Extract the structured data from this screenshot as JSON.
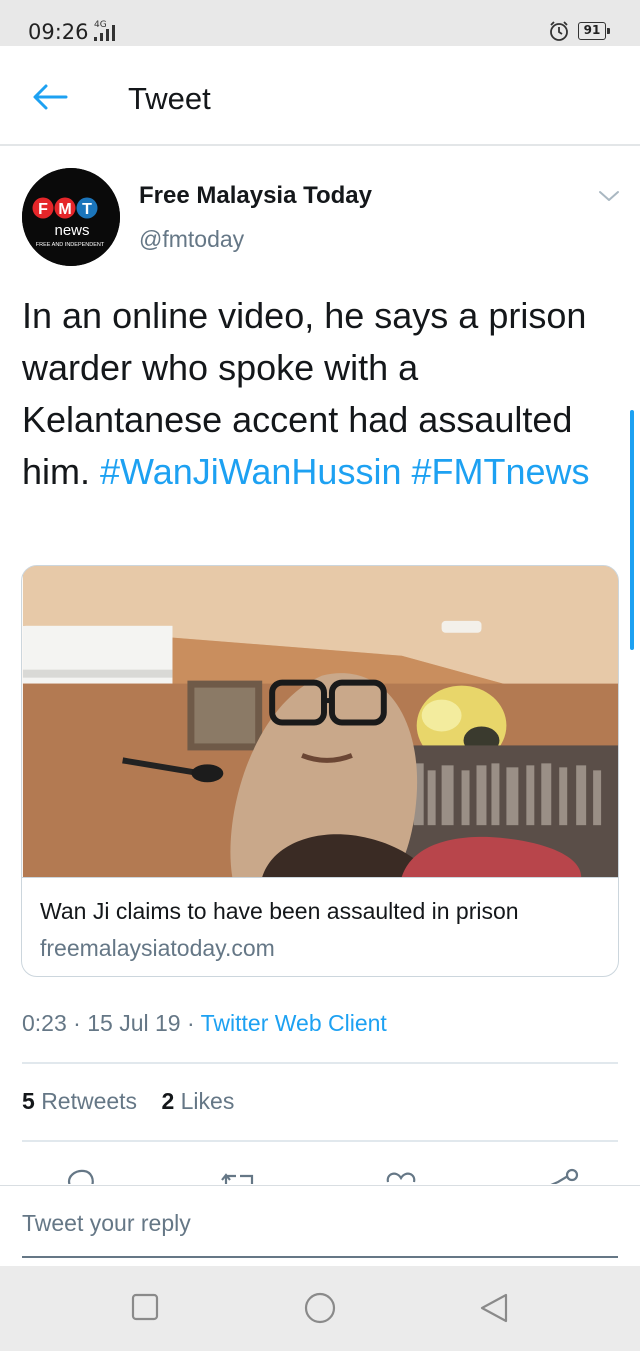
{
  "status_bar": {
    "time": "09:26",
    "network": "4G",
    "battery": "91"
  },
  "header": {
    "title": "Tweet"
  },
  "tweet": {
    "author_name": "Free Malaysia Today",
    "author_handle": "@fmtoday",
    "avatar_logo": {
      "letters": [
        "F",
        "M",
        "T"
      ],
      "word": "news",
      "tagline": "FREE AND INDEPENDENT"
    },
    "text": "In an online video, he says a prison warder who spoke with a Kelantanese accent had assaulted him.",
    "hashtags": [
      "#WanJiWanHussin",
      "#FMTnews"
    ],
    "card": {
      "title": "Wan Ji claims to have been assaulted in prison",
      "domain": "freemalaysiatoday.com"
    },
    "time": "0:23",
    "date": "15 Jul 19",
    "source": "Twitter Web Client",
    "retweets_count": "5",
    "retweets_label": "Retweets",
    "likes_count": "2",
    "likes_label": "Likes"
  },
  "reply": {
    "placeholder": "Tweet your reply"
  },
  "colors": {
    "accent": "#1da1f2",
    "muted": "#657786",
    "text": "#14171a",
    "logo_red": "#e5262a",
    "logo_blue": "#1b75bb"
  },
  "icons": {
    "back": "arrow-left-icon",
    "caret": "chevron-down-icon",
    "reply": "reply-icon",
    "retweet": "retweet-icon",
    "like": "heart-icon",
    "share": "share-icon",
    "nav_recent": "square-icon",
    "nav_home": "circle-icon",
    "nav_back": "triangle-back-icon"
  }
}
